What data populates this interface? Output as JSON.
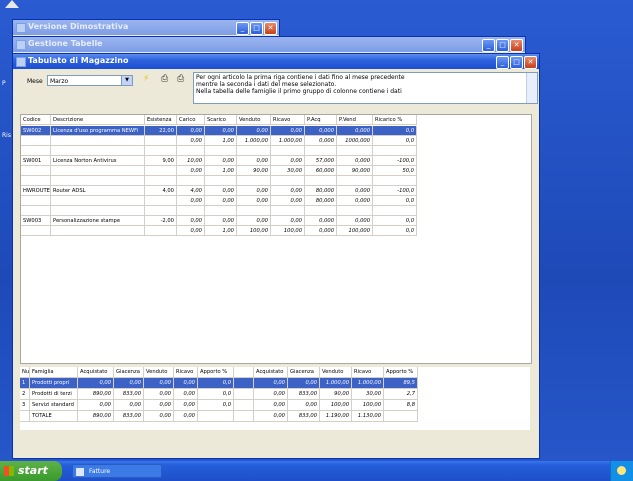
{
  "windows": {
    "demo": {
      "title": "Versione Dimostrativa"
    },
    "tables": {
      "title": "Gestione Tabelle"
    },
    "main": {
      "title": "Tabulato di Magazzino"
    }
  },
  "desktop": {
    "side_letters": [
      "P",
      "Ris"
    ]
  },
  "toolbar": {
    "month_label": "Mese",
    "month_value": "Marzo",
    "note_lines": [
      "Per ogni articolo la prima riga contiene i dati fino al mese precedente",
      "mentre la seconda i dati del mese selezionato.",
      "Nella tabella delle famiglie il primo gruppo di colonne contiene i dati"
    ]
  },
  "articles": {
    "headers": [
      "Codice",
      "Descrizione",
      "Esistenza",
      "Carico",
      "Scarico",
      "Venduto",
      "Ricavo",
      "P.Acq",
      "P.Vend",
      "Ricarico %"
    ],
    "rows": [
      {
        "selected": true,
        "cells": [
          "SW002",
          "Licenza d'uso programma NEWFi",
          "22,00",
          "0,00",
          "0,00",
          "0,00",
          "0,00",
          "0,000",
          "0,000",
          "0,0"
        ]
      },
      {
        "cells": [
          "",
          "",
          "",
          "0,00",
          "1,00",
          "1.000,00",
          "1.000,00",
          "0,000",
          "1000,000",
          "0,0"
        ]
      },
      {
        "cells": [
          "",
          "",
          "",
          "",
          "",
          "",
          "",
          "",
          "",
          ""
        ]
      },
      {
        "cells": [
          "SW001",
          "Licenza Norton Antivirus",
          "9,00",
          "10,00",
          "0,00",
          "0,00",
          "0,00",
          "57,000",
          "0,000",
          "-100,0"
        ]
      },
      {
        "cells": [
          "",
          "",
          "",
          "0,00",
          "1,00",
          "90,00",
          "30,00",
          "60,000",
          "90,000",
          "50,0"
        ]
      },
      {
        "cells": [
          "",
          "",
          "",
          "",
          "",
          "",
          "",
          "",
          "",
          ""
        ]
      },
      {
        "cells": [
          "HWROUTER",
          "Router ADSL",
          "4,00",
          "4,00",
          "0,00",
          "0,00",
          "0,00",
          "80,000",
          "0,000",
          "-100,0"
        ]
      },
      {
        "cells": [
          "",
          "",
          "",
          "0,00",
          "0,00",
          "0,00",
          "0,00",
          "80,000",
          "0,000",
          "0,0"
        ]
      },
      {
        "cells": [
          "",
          "",
          "",
          "",
          "",
          "",
          "",
          "",
          "",
          ""
        ]
      },
      {
        "cells": [
          "SW003",
          "Personalizzazione stampe",
          "-2,00",
          "0,00",
          "0,00",
          "0,00",
          "0,00",
          "0,000",
          "0,000",
          "0,0"
        ]
      },
      {
        "cells": [
          "",
          "",
          "",
          "0,00",
          "1,00",
          "100,00",
          "100,00",
          "0,000",
          "100,000",
          "0,0"
        ]
      }
    ]
  },
  "families": {
    "headers": [
      "Num",
      "Famiglia",
      "Acquistato",
      "Giacenza",
      "Venduto",
      "Ricavo",
      "Apporto %",
      "",
      "Acquistato",
      "Giacenza",
      "Venduto",
      "Ricavo",
      "Apporto %"
    ],
    "rows": [
      {
        "selected": true,
        "cells": [
          "1",
          "Prodotti propri",
          "0,00",
          "0,00",
          "0,00",
          "0,00",
          "0,0",
          "",
          "0,00",
          "0,00",
          "1.000,00",
          "1.000,00",
          "89,5"
        ]
      },
      {
        "cells": [
          "2",
          "Prodotti di terzi",
          "890,00",
          "833,00",
          "0,00",
          "0,00",
          "0,0",
          "",
          "0,00",
          "833,00",
          "90,00",
          "30,00",
          "2,7"
        ]
      },
      {
        "cells": [
          "3",
          "Servizi standard",
          "0,00",
          "0,00",
          "0,00",
          "0,00",
          "0,0",
          "",
          "0,00",
          "0,00",
          "100,00",
          "100,00",
          "8,8"
        ]
      },
      {
        "cells": [
          "",
          "TOTALE",
          "890,00",
          "833,00",
          "0,00",
          "0,00",
          "",
          "",
          "0,00",
          "833,00",
          "1.190,00",
          "1.130,00",
          ""
        ]
      }
    ]
  },
  "taskbar": {
    "start_label": "start",
    "task_label": "Fatture"
  },
  "colors": {
    "selection": "#3d62c6",
    "titlebar": "#1b4fd1",
    "desktop": "#2a5bd1"
  }
}
